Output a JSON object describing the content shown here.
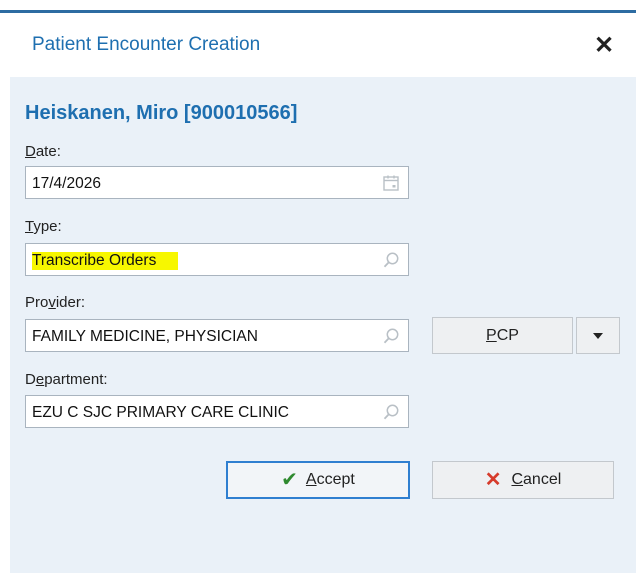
{
  "dialog": {
    "title": "Patient Encounter Creation",
    "close_icon": "close-icon"
  },
  "patient": {
    "name_id": "Heiskanen, Miro [900010566]"
  },
  "fields": {
    "date": {
      "label_pre": "",
      "label_u": "D",
      "label_post": "ate:",
      "value": "17/4/2026",
      "icon": "calendar-icon"
    },
    "type": {
      "label_pre": "",
      "label_u": "T",
      "label_post": "ype:",
      "value": "Transcribe Orders",
      "icon": "search-icon",
      "highlight": "#f7f700"
    },
    "provider": {
      "label_pre": "Pro",
      "label_u": "v",
      "label_post": "ider:",
      "value": "FAMILY MEDICINE, PHYSICIAN",
      "icon": "search-icon"
    },
    "department": {
      "label_pre": "D",
      "label_u": "e",
      "label_post": "partment:",
      "value": "EZU C SJC PRIMARY CARE CLINIC",
      "icon": "search-icon"
    }
  },
  "buttons": {
    "pcp": {
      "u": "P",
      "rest": "CP"
    },
    "accept": {
      "u": "A",
      "rest": "ccept"
    },
    "cancel": {
      "u": "C",
      "rest": "ancel"
    }
  },
  "colors": {
    "accent": "#1e6fb0",
    "panel": "#eaf1f8",
    "accept_border": "#2f7fd0",
    "cancel_x": "#d63b2b",
    "check": "#2f8a2f"
  }
}
